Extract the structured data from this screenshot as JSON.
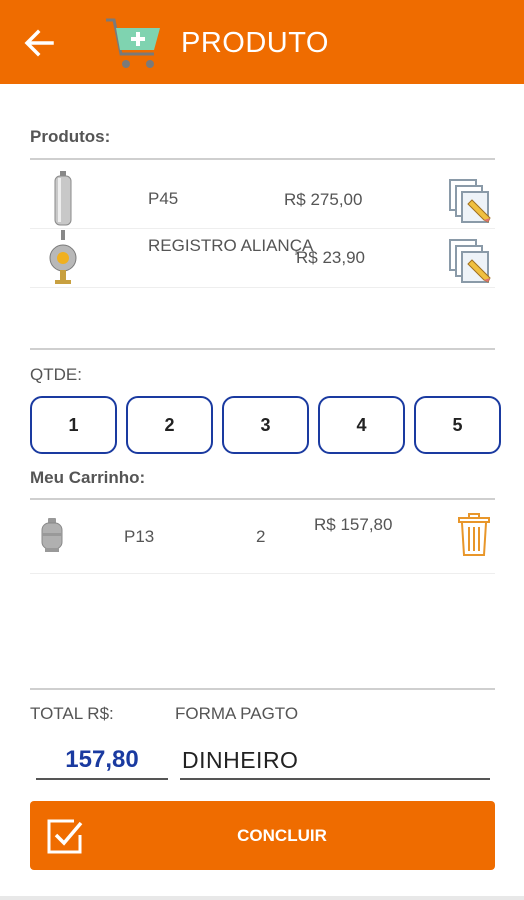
{
  "appbar": {
    "title": "PRODUTO",
    "back_icon": "arrow-left-icon",
    "cart_icon": "cart-plus-icon",
    "color": "#ef6c00"
  },
  "products": {
    "label": "Produtos:",
    "items": [
      {
        "name": "P45",
        "price": "R$ 275,00",
        "icon": "gas-cylinder-tall-icon"
      },
      {
        "name": "REGISTRO ALIANÇA",
        "price": "R$ 23,90",
        "icon": "gas-regulator-icon"
      }
    ]
  },
  "qtde": {
    "label": "QTDE:",
    "options": [
      "1",
      "2",
      "3",
      "4",
      "5"
    ]
  },
  "cart": {
    "label": "Meu Carrinho:",
    "items": [
      {
        "name": "P13",
        "qty": "2",
        "price": "R$ 157,80",
        "icon": "gas-cylinder-icon"
      }
    ]
  },
  "footer": {
    "total_label": "TOTAL R$:",
    "total_value": "157,80",
    "payment_label": "FORMA PAGTO",
    "payment_value": "DINHEIRO",
    "concluir_label": "CONCLUIR",
    "accent_color": "#1a3aa0"
  }
}
